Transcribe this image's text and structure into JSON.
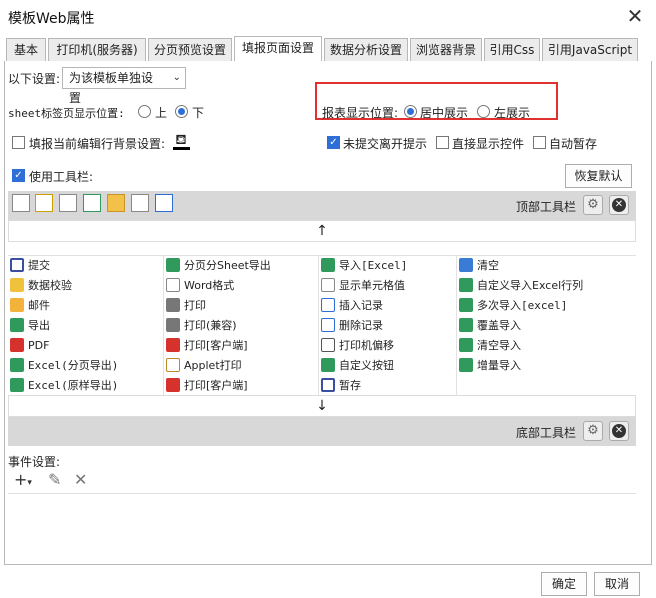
{
  "window": {
    "title": "模板Web属性",
    "close_glyph": "✕"
  },
  "tabs": [
    {
      "label": "基本"
    },
    {
      "label": "打印机(服务器)"
    },
    {
      "label": "分页预览设置"
    },
    {
      "label": "填报页面设置"
    },
    {
      "label": "数据分析设置"
    },
    {
      "label": "浏览器背景"
    },
    {
      "label": "引用Css"
    },
    {
      "label": "引用JavaScript"
    }
  ],
  "active_tab": "填报页面设置",
  "settings": {
    "scope_label": "以下设置:",
    "scope_value": "为该模板单独设置",
    "sheet_pos_label": "sheet标签页显示位置:",
    "sheet_pos_options": [
      "上",
      "下"
    ],
    "sheet_pos_selected": "下",
    "report_pos_label": "报表显示位置:",
    "report_pos_options": [
      "居中展示",
      "左展示"
    ],
    "report_pos_selected": "居中展示",
    "fill_bg_label": "填报当前编辑行背景设置:",
    "unsubmitted_label": "未提交离开提示",
    "direct_show_label": "直接显示控件",
    "auto_save_label": "自动暂存",
    "use_toolbar_label": "使用工具栏:",
    "restore_default": "恢复默认"
  },
  "toolbar": {
    "top_label": "顶部工具栏",
    "bottom_label": "底部工具栏",
    "up_arrow": "↑",
    "down_arrow": "↓"
  },
  "buttons_grid": [
    [
      "提交",
      "分页分Sheet导出",
      "导入[Excel]",
      "清空"
    ],
    [
      "数据校验",
      "Word格式",
      "显示单元格值",
      "自定义导入Excel行列"
    ],
    [
      "邮件",
      "打印",
      "插入记录",
      "多次导入[excel]"
    ],
    [
      "导出",
      "打印(兼容)",
      "删除记录",
      "覆盖导入"
    ],
    [
      "PDF",
      "打印[客户端]",
      "打印机偏移",
      "清空导入"
    ],
    [
      "Excel(分页导出)",
      "Applet打印",
      "自定义按钮",
      "增量导入"
    ],
    [
      "Excel(原样导出)",
      "打印[客户端]",
      "暂存",
      ""
    ]
  ],
  "events": {
    "label": "事件设置:"
  },
  "footer": {
    "ok": "确定",
    "cancel": "取消"
  },
  "colors": {
    "accent": "#2d6fd6",
    "highlight": "#e03030"
  }
}
